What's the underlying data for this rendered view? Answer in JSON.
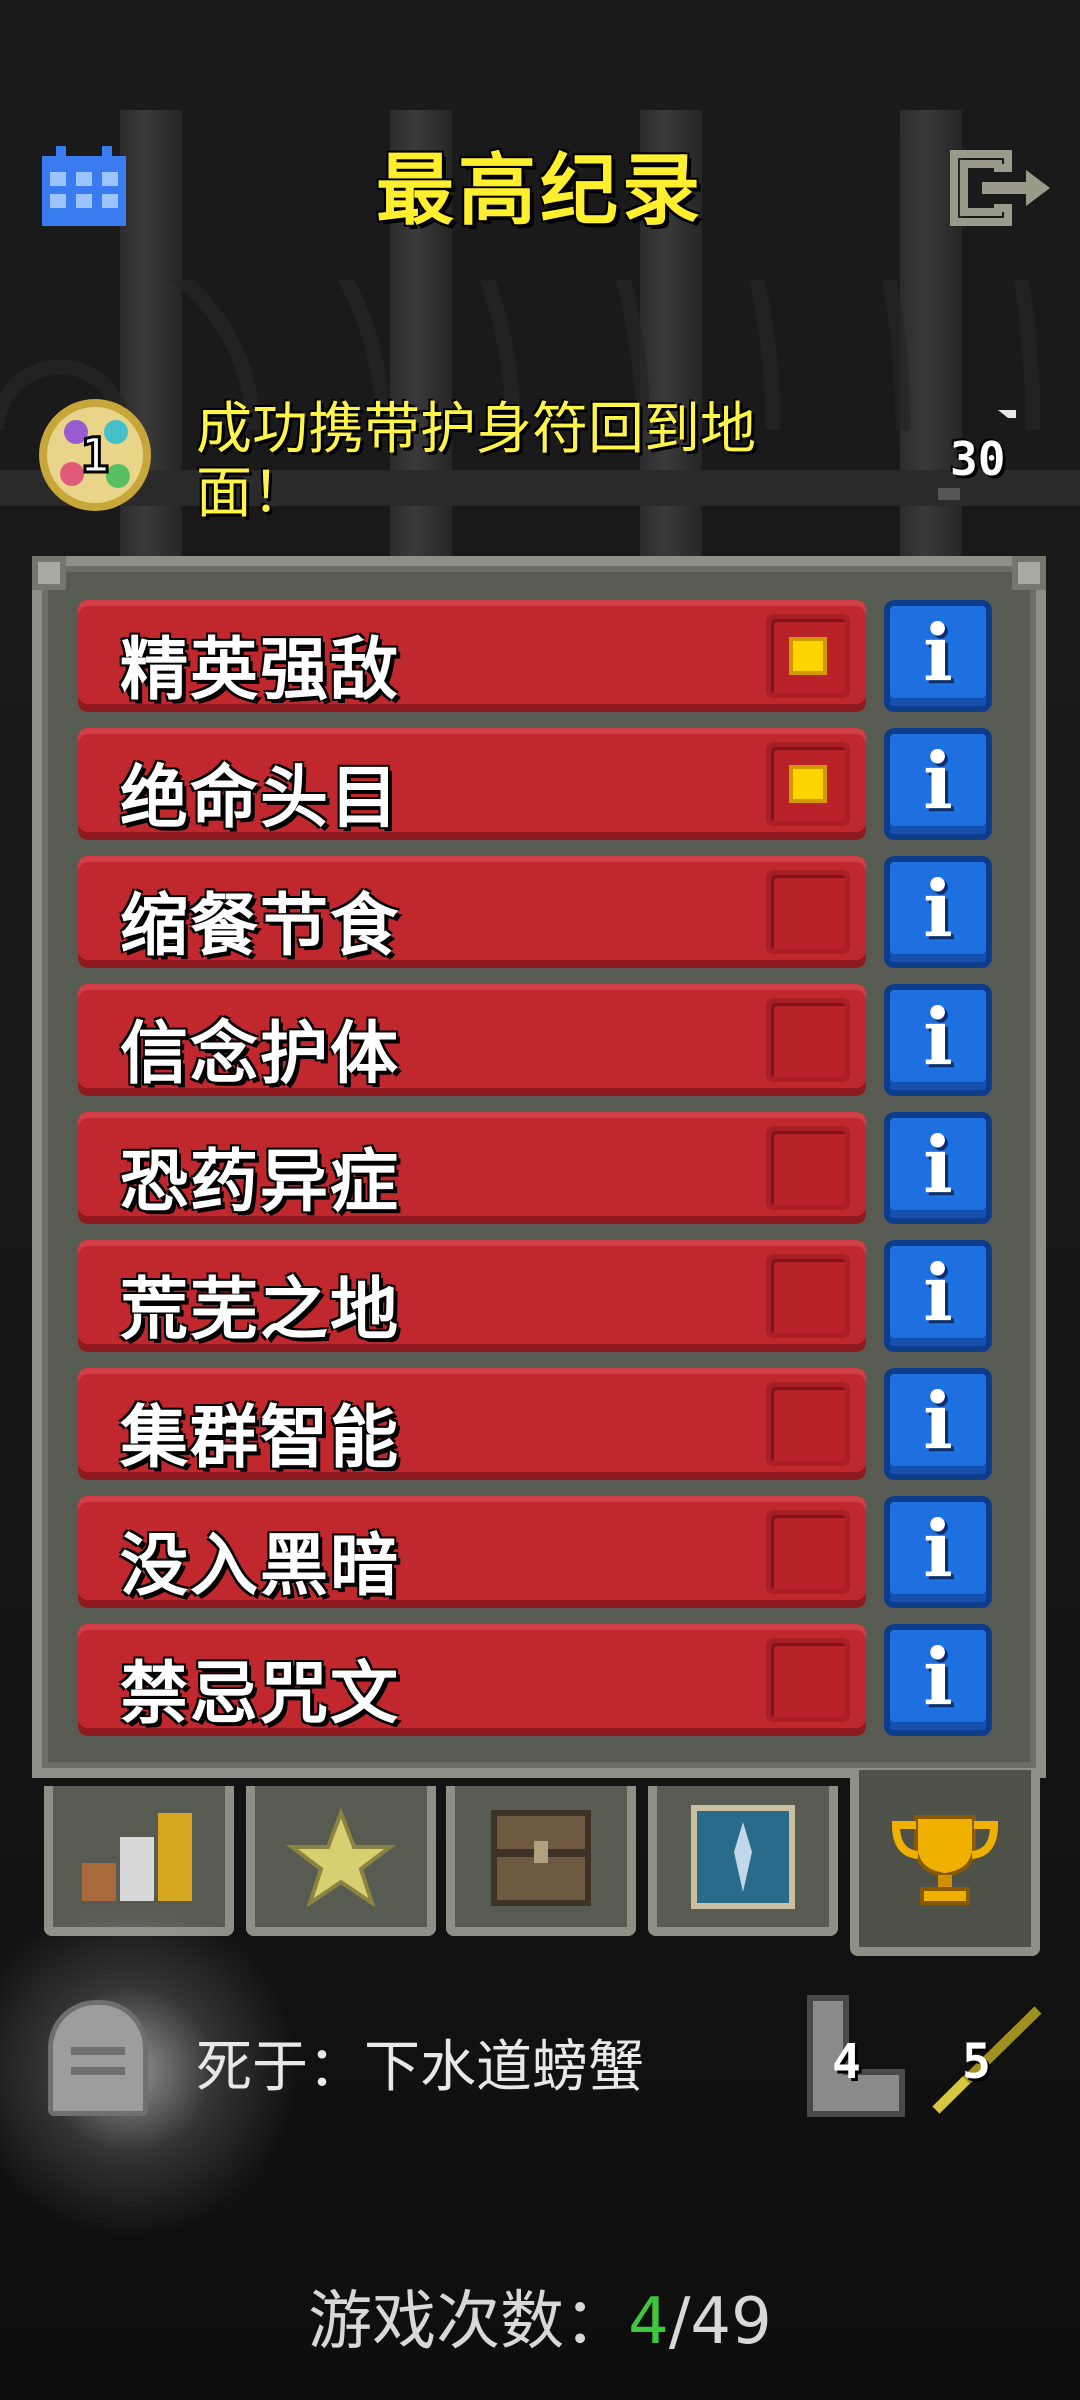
{
  "header": {
    "title": "最高纪录",
    "calendar_icon": "calendar-icon",
    "exit_icon": "exit-icon"
  },
  "badge": {
    "icon": "amulet-badge-icon",
    "number": "1",
    "text": "成功携带护身符回到地面！",
    "depth_icon": "depth-icon",
    "depth": "30"
  },
  "challenges": [
    {
      "label": "精英强敌",
      "checked": true
    },
    {
      "label": "绝命头目",
      "checked": true
    },
    {
      "label": "缩餐节食",
      "checked": false
    },
    {
      "label": "信念护体",
      "checked": false
    },
    {
      "label": "恐药异症",
      "checked": false
    },
    {
      "label": "荒芜之地",
      "checked": false
    },
    {
      "label": "集群智能",
      "checked": false
    },
    {
      "label": "没入黑暗",
      "checked": false
    },
    {
      "label": "禁忌咒文",
      "checked": false
    }
  ],
  "info_label": "i",
  "tabs": [
    {
      "icon": "stats-bars-icon"
    },
    {
      "icon": "star-icon"
    },
    {
      "icon": "chest-icon"
    },
    {
      "icon": "badge-card-icon"
    },
    {
      "icon": "trophy-icon",
      "active": true
    }
  ],
  "last_run": {
    "tomb_icon": "tombstone-icon",
    "death_text": "死于：下水道螃蟹",
    "depth_icon": "boot-icon",
    "depth": "4",
    "level_icon": "wand-icon",
    "level": "5"
  },
  "games": {
    "label": "游戏次数：",
    "current": "4",
    "total": "/49"
  },
  "colors": {
    "title": "#ffef2e",
    "row": "#c0282e",
    "info": "#1e6fe0",
    "check": "#ffd400",
    "games_current": "#3fc63f"
  }
}
